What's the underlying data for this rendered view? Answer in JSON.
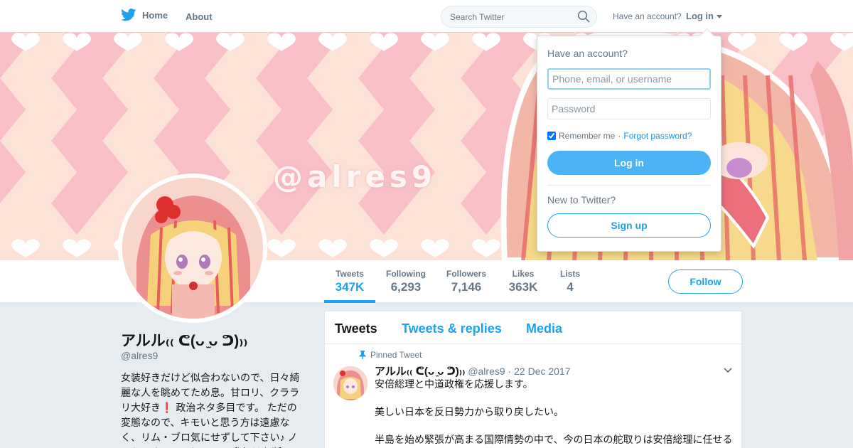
{
  "topbar": {
    "home_label": "Home",
    "about_label": "About",
    "search_placeholder": "Search Twitter",
    "have_account": "Have an account?",
    "login_label": "Log in"
  },
  "banner": {
    "handle_text": "@alres9"
  },
  "stats": [
    {
      "label": "Tweets",
      "value": "347K"
    },
    {
      "label": "Following",
      "value": "6,293"
    },
    {
      "label": "Followers",
      "value": "7,146"
    },
    {
      "label": "Likes",
      "value": "363K"
    },
    {
      "label": "Lists",
      "value": "4"
    }
  ],
  "follow_label": "Follow",
  "profile": {
    "name": "アルル₍₍ ᕦ(ᴗ ̫ᴗ ᕤ)₎₎",
    "handle": "@alres9",
    "bio": "女装好きだけど似合わないので、日々綺麗な人を眺めてため息。甘ロリ、クララリ大好き❗ 政治ネタ多目です。 ただの変態なので、キモいと思う方は遠慮なく、リム・ブロ気にせずして下さい♪ ノンケです。♂です。 GDM参加はお断"
  },
  "timeline": {
    "tabs": [
      "Tweets",
      "Tweets & replies",
      "Media"
    ],
    "pinned_label": "Pinned Tweet",
    "tweet": {
      "name": "アルル₍₍ ᕦ(ᴗ ̫ᴗ ᕤ)₎₎",
      "handle": "@alres9",
      "date": "22 Dec 2017",
      "lines": [
        "安倍総理と中道政権を応援します。",
        "美しい日本を反日勢力から取り戻したい。",
        "半島を始め緊張が高まる国際情勢の中で、今の日本の舵取りは安倍総理に任せる"
      ]
    }
  },
  "login_dropdown": {
    "title": "Have an account?",
    "username_placeholder": "Phone, email, or username",
    "password_placeholder": "Password",
    "remember_label": "Remember me",
    "separator": "·",
    "forgot_label": "Forgot password?",
    "login_button": "Log in",
    "new_label": "New to Twitter?",
    "signup_button": "Sign up"
  },
  "colors": {
    "accent": "#1da1f2",
    "banner_pink": "#f7b8c4",
    "banner_peach": "#fde2d8"
  }
}
